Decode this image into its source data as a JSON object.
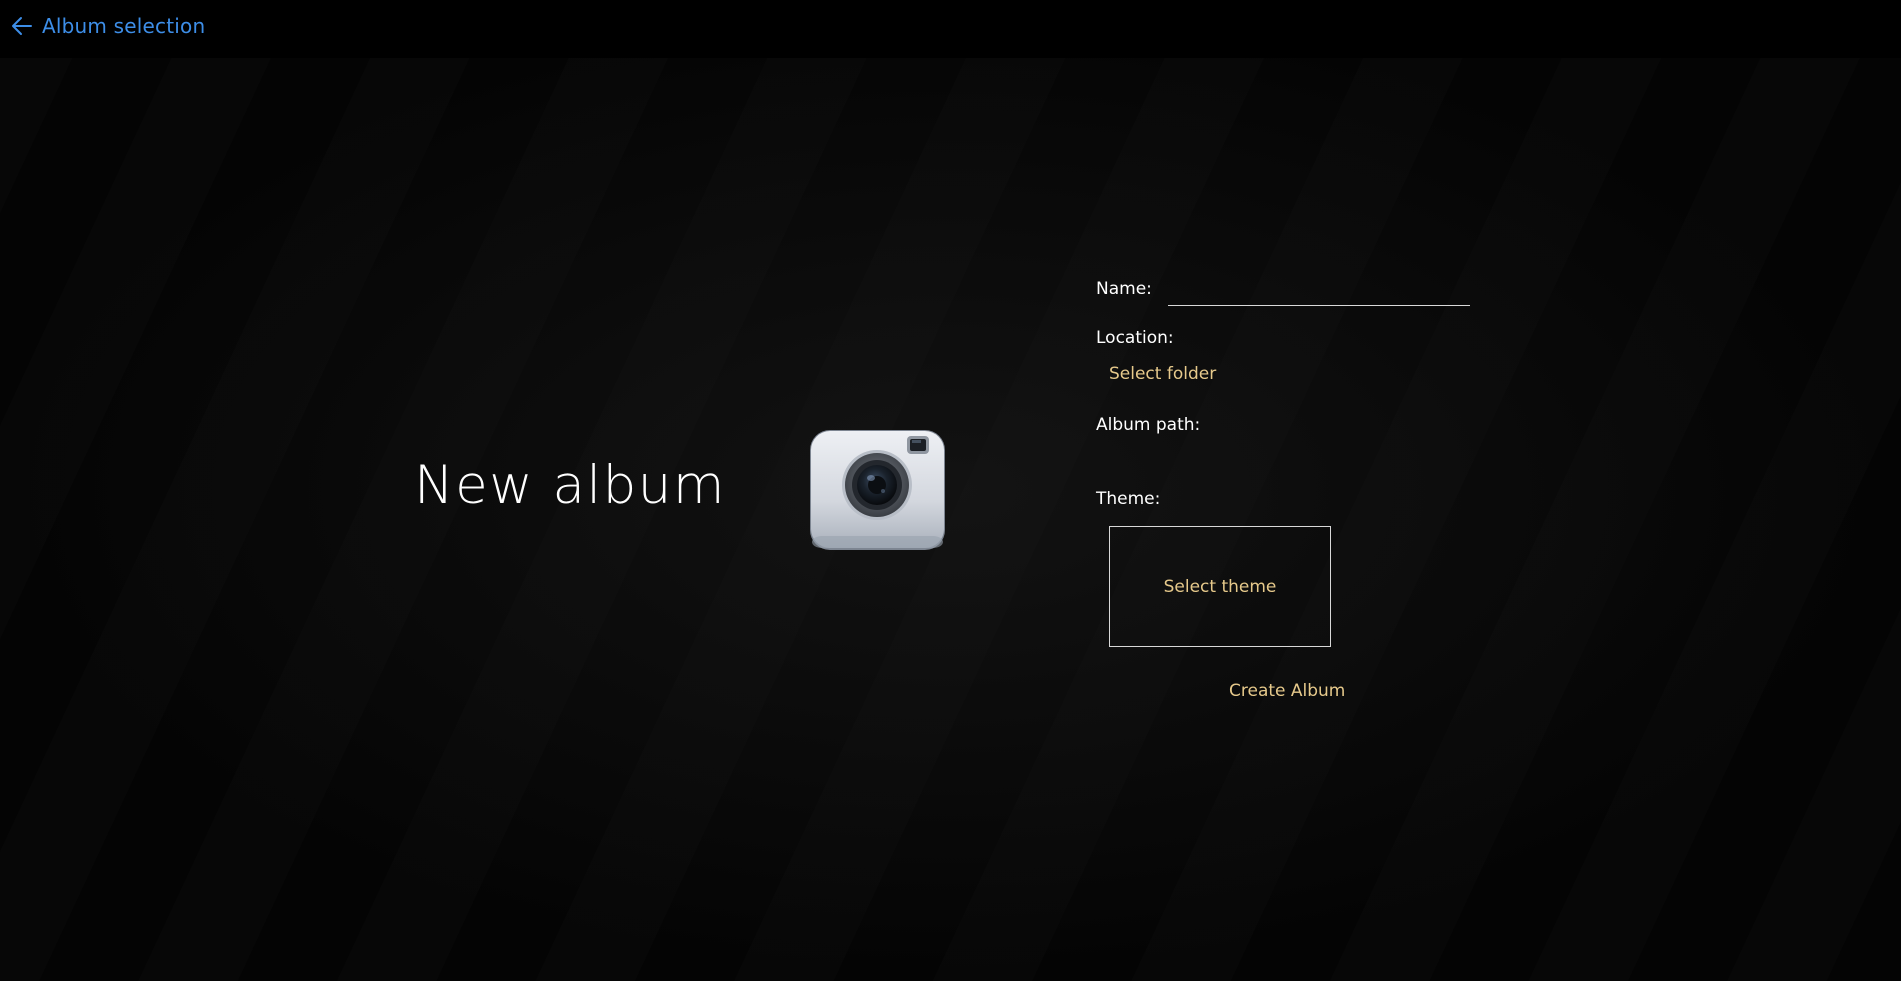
{
  "header": {
    "back_label": "Album selection",
    "back_icon": "arrow-left-icon"
  },
  "main": {
    "title": "New album",
    "illustration_icon": "camera-icon"
  },
  "form": {
    "name_label": "Name:",
    "name_value": "",
    "location_label": "Location:",
    "select_folder_label": "Select folder",
    "album_path_label": "Album path:",
    "album_path_value": "",
    "theme_label": "Theme:",
    "select_theme_label": "Select theme",
    "create_label": "Create Album"
  },
  "colors": {
    "link_blue": "#3d8ee8",
    "accent_gold": "#e6c98b",
    "text_white": "#ffffff",
    "background": "#040404"
  }
}
